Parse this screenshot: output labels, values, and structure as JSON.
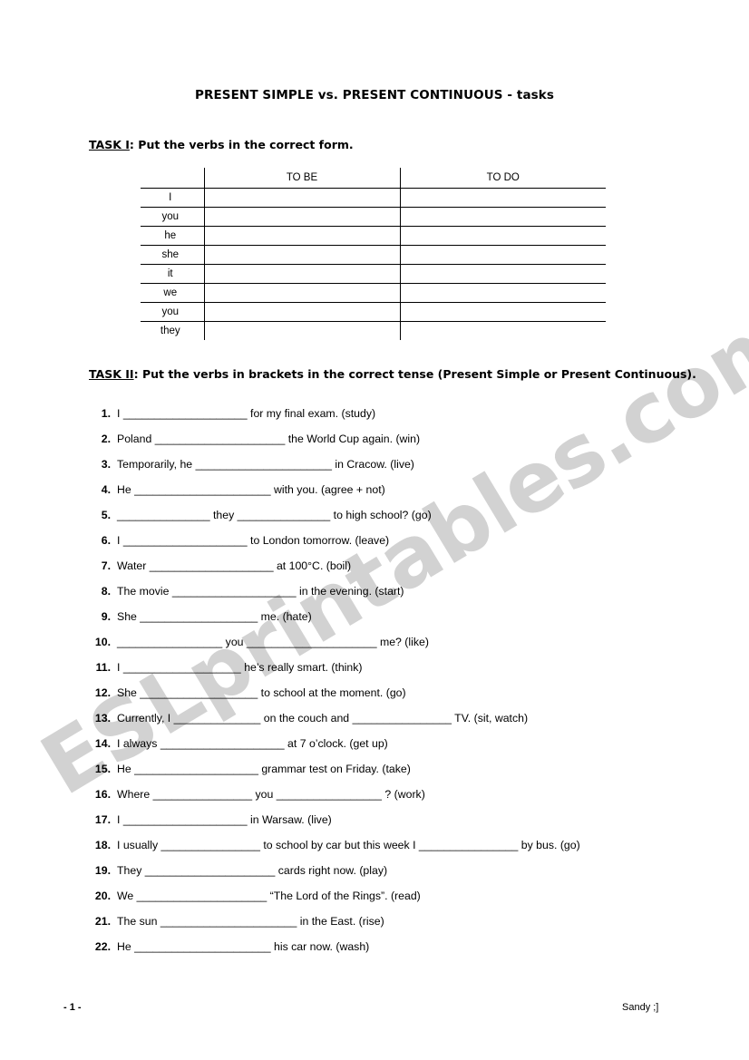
{
  "document": {
    "title": "PRESENT SIMPLE vs. PRESENT CONTINUOUS - tasks",
    "watermark": "ESLprintables.com",
    "watermark_color": "#d2d2d2"
  },
  "task1": {
    "label": "TASK I",
    "separator": ": ",
    "instruction": "Put the verbs in the correct form.",
    "table": {
      "headers": [
        "",
        "TO BE",
        "TO DO"
      ],
      "rows": [
        {
          "pronoun": "I",
          "to_be": "",
          "to_do": ""
        },
        {
          "pronoun": "you",
          "to_be": "",
          "to_do": ""
        },
        {
          "pronoun": "he",
          "to_be": "",
          "to_do": ""
        },
        {
          "pronoun": "she",
          "to_be": "",
          "to_do": ""
        },
        {
          "pronoun": "it",
          "to_be": "",
          "to_do": ""
        },
        {
          "pronoun": "we",
          "to_be": "",
          "to_do": ""
        },
        {
          "pronoun": "you",
          "to_be": "",
          "to_do": ""
        },
        {
          "pronoun": "they",
          "to_be": "",
          "to_do": ""
        }
      ]
    }
  },
  "task2": {
    "label": "TASK II",
    "separator": ": ",
    "instruction": "Put the verbs in brackets in the correct tense (Present Simple or Present Continuous).",
    "items": [
      {
        "num": "1.",
        "text": "I ____________________ for my final exam. (study)"
      },
      {
        "num": "2.",
        "text": "Poland _____________________ the World Cup again. (win)"
      },
      {
        "num": "3.",
        "text": "Temporarily, he ______________________ in Cracow. (live)"
      },
      {
        "num": "4.",
        "text": "He ______________________ with you. (agree + not)"
      },
      {
        "num": "5.",
        "text": "_______________ they _______________ to high school? (go)"
      },
      {
        "num": "6.",
        "text": "I ____________________ to London tomorrow. (leave)"
      },
      {
        "num": "7.",
        "text": "Water ____________________ at 100°C. (boil)"
      },
      {
        "num": "8.",
        "text": "The movie ____________________ in the evening. (start)"
      },
      {
        "num": "9.",
        "text": "She ___________________ me. (hate)"
      },
      {
        "num": "10.",
        "text": "_________________ you _____________________ me? (like)"
      },
      {
        "num": "11.",
        "text": "I ___________________ he’s really smart. (think)"
      },
      {
        "num": "12.",
        "text": "She ___________________ to school at the moment. (go)"
      },
      {
        "num": "13.",
        "text": "Currently, I ______________ on the couch and ________________ TV. (sit, watch)"
      },
      {
        "num": "14.",
        "text": "I always ____________________ at 7 o’clock. (get up)"
      },
      {
        "num": "15.",
        "text": "He ____________________ grammar test on Friday. (take)"
      },
      {
        "num": "16.",
        "text": "Where ________________ you _________________ ? (work)"
      },
      {
        "num": "17.",
        "text": "I ____________________ in Warsaw. (live)"
      },
      {
        "num": "18.",
        "text": "I usually ________________ to school by car but this week I ________________ by bus. (go)"
      },
      {
        "num": "19.",
        "text": "They _____________________ cards right now. (play)"
      },
      {
        "num": "20.",
        "text": "We _____________________ “The Lord of the Rings”. (read)"
      },
      {
        "num": "21.",
        "text": "The sun ______________________ in the East. (rise)"
      },
      {
        "num": "22.",
        "text": "He ______________________ his car now. (wash)"
      }
    ]
  },
  "footer": {
    "page_number": "- 1 -",
    "author": "Sandy ;]"
  }
}
